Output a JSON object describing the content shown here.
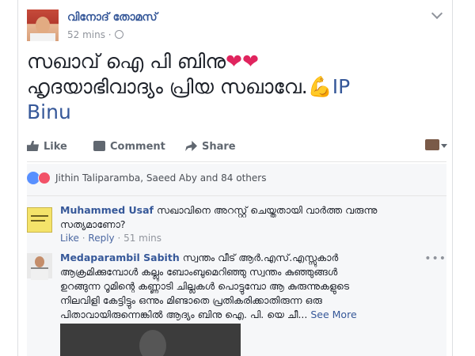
{
  "post": {
    "author": "വിനോദ് തോമസ്",
    "time": "52 mins",
    "text_line1": "സഖാവ് ഐ പി ബിനു",
    "text_line1_emoji": "❤❤",
    "text_line2": "ഹൃദയാഭിവാദ്യം പ്രിയ സഖാവേ.",
    "text_line2_emoji": "💪",
    "text_tag_part1": "IP",
    "text_tag_part2": "Binu"
  },
  "actions": {
    "like": "Like",
    "comment": "Comment",
    "share": "Share"
  },
  "reactions": {
    "summary": "Jithin Taliparamba, Saeed Aby and 84 others"
  },
  "comments": [
    {
      "name": "Muhammed Usaf",
      "text_line1": "സഖാവിനെ അറസ്റ്റ് ചെയ്തതായി വാർത്ത വരുന്നു",
      "text_line2": "സത്യമാണോ?",
      "like_label": "Like",
      "reply_label": "Reply",
      "time": "51 mins"
    },
    {
      "name": "Medaparambil Sabith",
      "text_line1": "സ്വന്തം വീട് ആർ.എസ്.എസ്സുകാർ",
      "text_line2": "ആക്രമിക്കുമ്പോൾ കല്ലും ബോംബുമെറിഞ്ഞു സ്വന്തം കുഞ്ഞുങ്ങൾ",
      "text_line3": "ഉറങ്ങുന്ന റൂമിന്റെ കണ്ണാടി ചില്ലകൾ പൊട്ടുമ്പോ ആ കുരുന്നുകളുടെ",
      "text_line4": "നിലവിളി കേട്ടിട്ടും ഒന്നും മിണ്ടാതെ പ്രതികരിക്കാതിരുന്ന ഒരു",
      "text_line5": "പിതാവായിരുന്നെങ്കിൽ ആദ്യം ബിനു ഐ. പി. യെ ചീ...",
      "see_more": "See More"
    }
  ]
}
